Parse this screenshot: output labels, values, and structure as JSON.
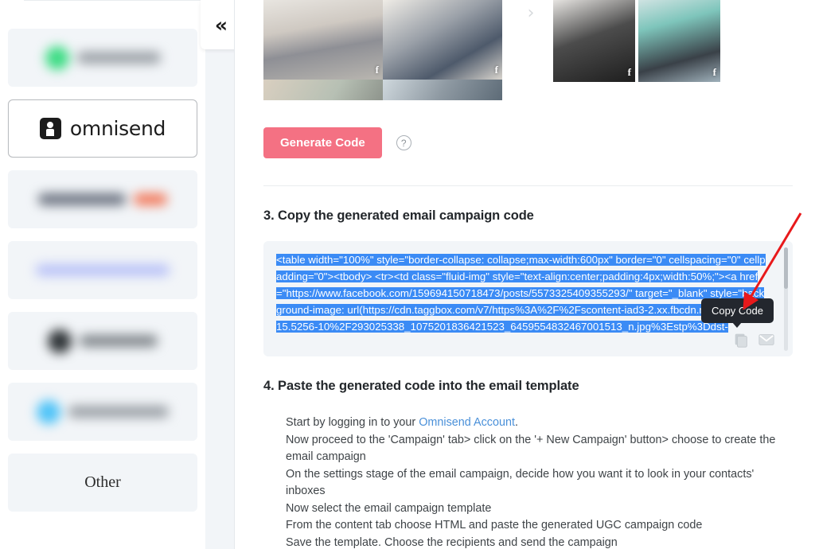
{
  "sidebar": {
    "items": [
      {
        "id": "platform-1",
        "label": "",
        "state": "blurred",
        "dot_color": "#3ddc84",
        "bar_color": "#9aa0a6"
      },
      {
        "id": "platform-omnisend",
        "label": "omnisend",
        "state": "selected"
      },
      {
        "id": "platform-3",
        "label": "",
        "state": "blurred",
        "dot_color": "#6b7280",
        "bar_color": "#f2795b"
      },
      {
        "id": "platform-4",
        "label": "",
        "state": "blurred",
        "dot_color": "#aab6f5",
        "bar_color": "#b9c2f7"
      },
      {
        "id": "platform-5",
        "label": "",
        "state": "blurred",
        "dot_color": "#2f3437",
        "bar_color": "#80868b"
      },
      {
        "id": "platform-6",
        "label": "",
        "state": "blurred",
        "dot_color": "#4fc3f7",
        "bar_color": "#9aa0a6"
      },
      {
        "id": "platform-other",
        "label": "Other",
        "state": "default"
      }
    ]
  },
  "collapse": {
    "icon": "double-chevron-left-icon",
    "glyph": "«"
  },
  "gallery": {
    "next_arrow_glyph": "›",
    "thumbnails": [
      {
        "id": "thumb-1",
        "source_badge": "f"
      },
      {
        "id": "thumb-2",
        "source_badge": "f"
      },
      {
        "id": "thumb-3",
        "source_badge": ""
      },
      {
        "id": "thumb-4",
        "source_badge": ""
      },
      {
        "id": "thumb-5",
        "source_badge": "f"
      },
      {
        "id": "thumb-6",
        "source_badge": "f"
      }
    ]
  },
  "actions": {
    "generate_code_label": "Generate Code",
    "generate_code_color": "#f47183",
    "help_icon": "question-mark-icon",
    "help_glyph": "?"
  },
  "step3": {
    "heading": "3. Copy the generated email campaign code",
    "code": "<table width=\"100%\" style=\"border-collapse: collapse;max-width:600px\" border=\"0\" cellspacing=\"0\" cellpadding=\"0\"><tbody> <tr><td class=\"fluid-img\" style=\"text-align:center;padding:4px;width:50%;\"><a href=\"https://www.facebook.com/159694150718473/posts/5573325409355293/\" target=\"_blank\" style=\"background-image: url(https://cdn.taggbox.com/v7/https%3A%2F%2Fscontent-iad3-2.xx.fbcdn.net%2Fv%2Ft15.5256-10%2F293025338_1075201836421523_6459554832467001513_n.jpg%3Estp%3Ddst-",
    "selection_color": "#3b8bf5",
    "tooltip": "Copy Code",
    "copy_icon": "copy-icon",
    "email_icon": "envelope-icon"
  },
  "step4": {
    "heading": "4. Paste the generated code into the email template",
    "lines": [
      {
        "text_before": "Start by logging in to your ",
        "link": "Omnisend Account",
        "text_after": "."
      },
      {
        "text_before": "Now proceed to the 'Campaign' tab> click on the '+ New Campaign' button> choose to create the email campaign",
        "link": "",
        "text_after": ""
      },
      {
        "text_before": "On the settings stage of the email campaign, decide how you want it to look in your contacts' inboxes",
        "link": "",
        "text_after": ""
      },
      {
        "text_before": "Now select the email campaign template",
        "link": "",
        "text_after": ""
      },
      {
        "text_before": "From the content tab choose HTML and paste the generated UGC campaign code",
        "link": "",
        "text_after": ""
      },
      {
        "text_before": "Save the template. Choose the recipients and send the campaign",
        "link": "",
        "text_after": ""
      }
    ],
    "link_color": "#4a90d9"
  },
  "annotation": {
    "arrow_color": "#e8191b",
    "points_to": "copy-code-button"
  }
}
